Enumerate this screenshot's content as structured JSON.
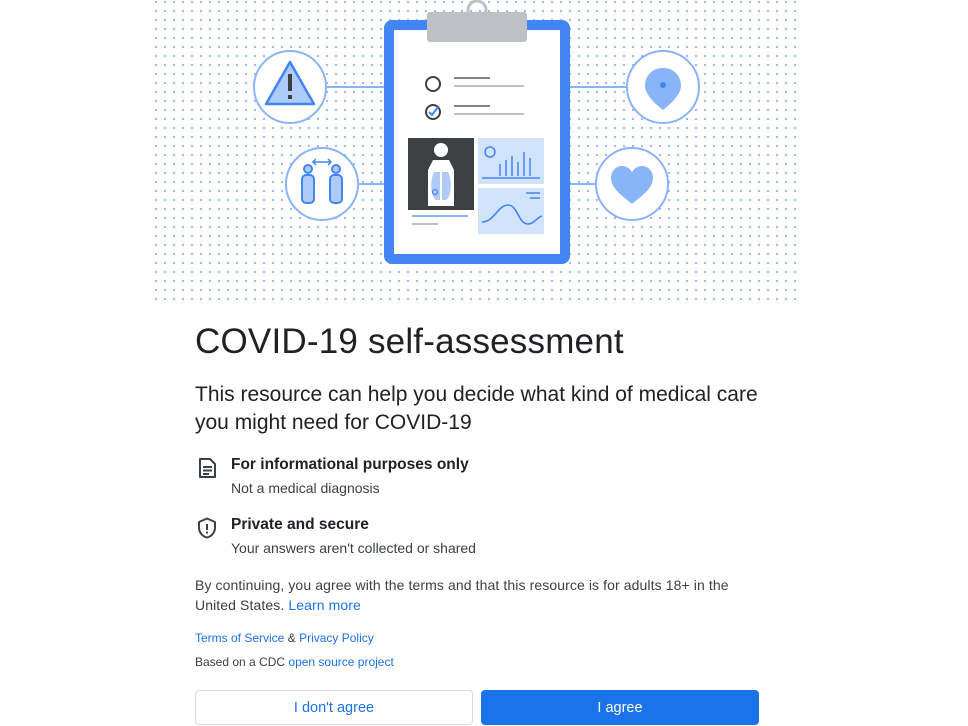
{
  "hero": {
    "name": "clipboard-illustration"
  },
  "title": "COVID-19 self-assessment",
  "subtitle": "This resource can help you decide what kind of medical care you might need for COVID-19",
  "features": [
    {
      "icon": "document-icon",
      "heading": "For informational purposes only",
      "sub": "Not a medical diagnosis"
    },
    {
      "icon": "shield-icon",
      "heading": "Private and secure",
      "sub": "Your answers aren't collected or shared"
    }
  ],
  "terms": {
    "text": "By continuing, you agree with the terms and that this resource is for adults 18+ in the United States.",
    "learn_more": "Learn more"
  },
  "links": {
    "tos": "Terms of Service",
    "amp": "&",
    "privacy": "Privacy Policy",
    "cdc_prefix": "Based on a CDC",
    "cdc_link": "open source project"
  },
  "buttons": {
    "disagree": "I don't agree",
    "agree": "I agree"
  },
  "colors": {
    "accent": "#1a73e8",
    "illustration_blue": "#4285f4",
    "light_blue": "#aecbfa",
    "text": "#202124"
  }
}
